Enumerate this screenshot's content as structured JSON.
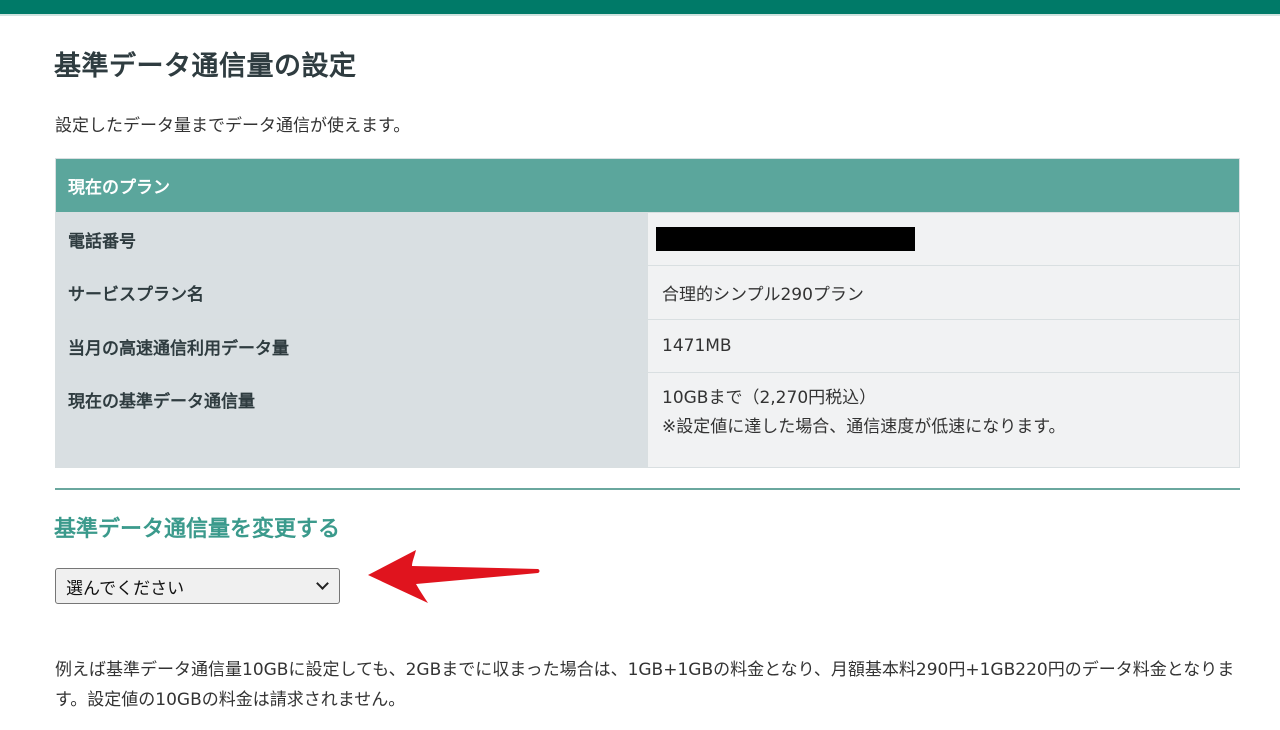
{
  "page": {
    "title": "基準データ通信量の設定",
    "description": "設定したデータ量までデータ通信が使えます。"
  },
  "plan_table": {
    "header": "現在のプラン",
    "rows": [
      {
        "label": "電話番号",
        "value": ""
      },
      {
        "label": "サービスプラン名",
        "value": "合理的シンプル290プラン"
      },
      {
        "label": "当月の高速通信利用データ量",
        "value": "1471MB"
      },
      {
        "label": "現在の基準データ通信量",
        "value": "10GBまで（2,270円税込）",
        "note": "※設定値に達した場合、通信速度が低速になります。"
      }
    ]
  },
  "change_section": {
    "heading": "基準データ通信量を変更する",
    "select_value": "選んでください"
  },
  "footnote": "例えば基準データ通信量10GBに設定しても、2GBまでに収まった場合は、1GB+1GBの料金となり、月額基本料290円+1GB220円のデータ料金となります。設定値の10GBの料金は請求されません。",
  "colors": {
    "topbar": "#007a68",
    "table_header": "#5ba69c",
    "section_heading": "#3b9a8c",
    "annotation_arrow": "#e0141e"
  },
  "icons": {
    "select_chevron": "chevron-down-icon",
    "annotation": "red-arrow-icon"
  }
}
